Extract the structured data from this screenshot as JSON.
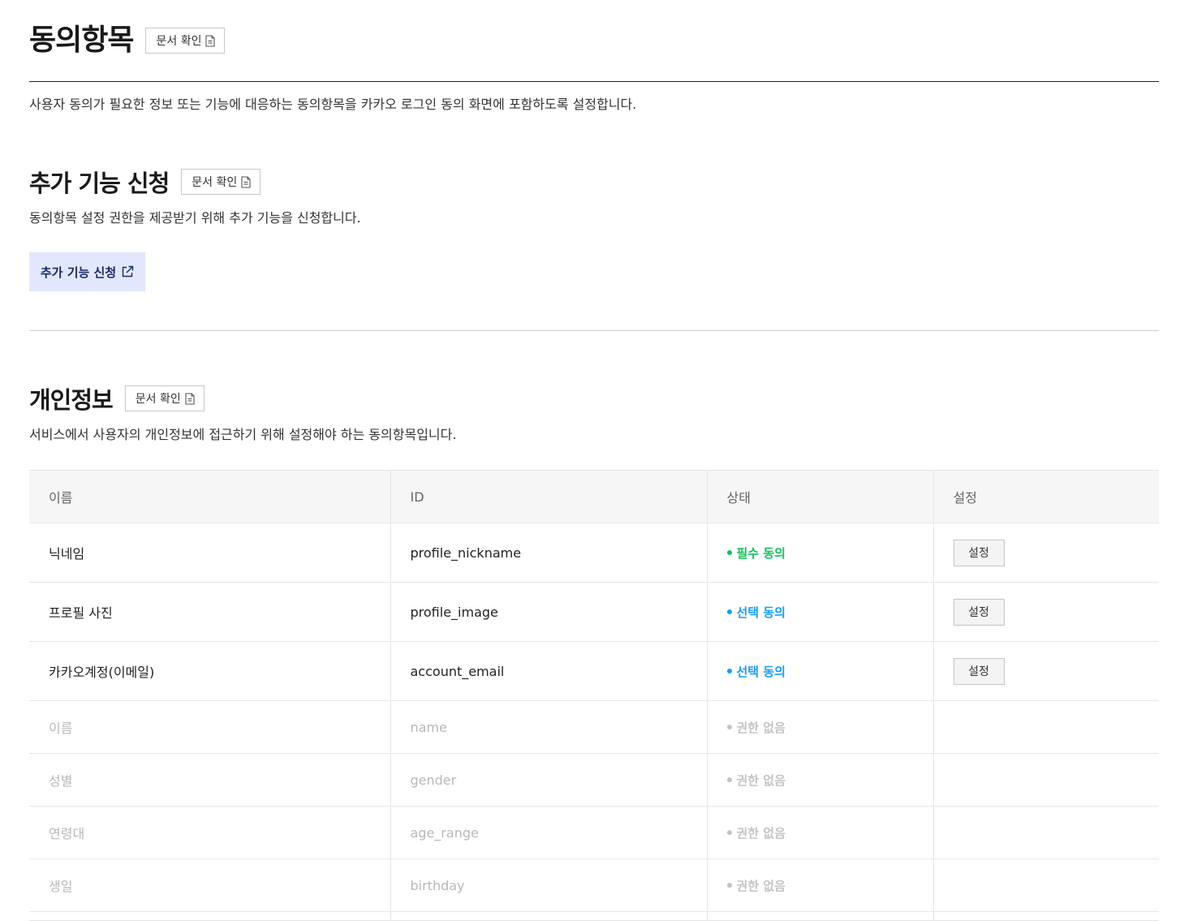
{
  "page": {
    "title": "동의항목",
    "doc_button_label": "문서 확인",
    "description": "사용자 동의가 필요한 정보 또는 기능에 대응하는 동의항목을 카카오 로그인 동의 화면에 포함하도록 설정합니다."
  },
  "additional": {
    "title": "추가 기능 신청",
    "doc_button_label": "문서 확인",
    "description": "동의항목 설정 권한을 제공받기 위해 추가 기능을 신청합니다.",
    "apply_button_label": "추가 기능 신청"
  },
  "personal": {
    "title": "개인정보",
    "doc_button_label": "문서 확인",
    "description": "서비스에서 사용자의 개인정보에 접근하기 위해 설정해야 하는 동의항목입니다.",
    "columns": [
      "이름",
      "ID",
      "상태",
      "설정"
    ],
    "rows": [
      {
        "name": "닉네임",
        "id": "profile_nickname",
        "status": "필수 동의",
        "status_color": "#15c05a",
        "setting": "설정"
      },
      {
        "name": "프로필 사진",
        "id": "profile_image",
        "status": "선택 동의",
        "status_color": "#1a9cf0",
        "setting": "설정"
      },
      {
        "name": "카카오계정(이메일)",
        "id": "account_email",
        "status": "선택 동의",
        "status_color": "#1a9cf0",
        "setting": "설정"
      },
      {
        "name": "이름",
        "id": "name",
        "status": "권한 없음",
        "status_color": "#c4c4c4"
      },
      {
        "name": "성별",
        "id": "gender",
        "status": "권한 없음",
        "status_color": "#c4c4c4"
      },
      {
        "name": "연령대",
        "id": "age_range",
        "status": "권한 없음",
        "status_color": "#c4c4c4"
      },
      {
        "name": "생일",
        "id": "birthday",
        "status": "권한 없음",
        "status_color": "#c4c4c4"
      }
    ]
  },
  "icons": {
    "doc": "document-icon",
    "external": "external-link-icon"
  }
}
